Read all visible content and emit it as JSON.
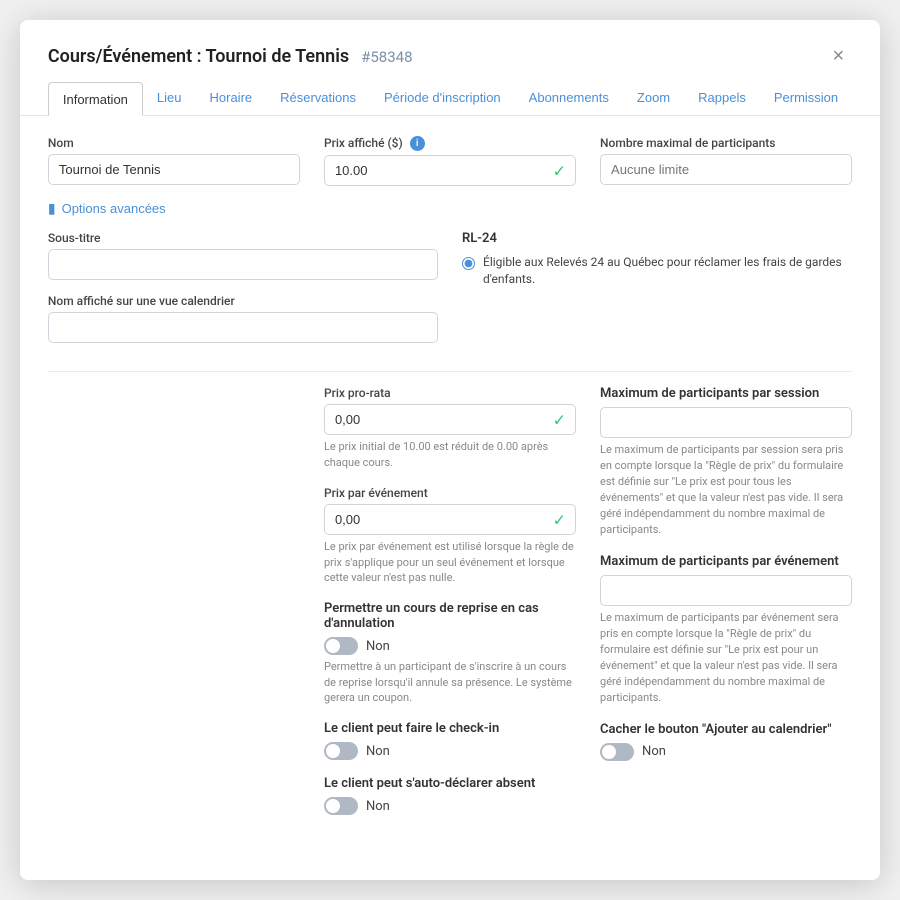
{
  "modal": {
    "title": "Cours/Événement : Tournoi de Tennis",
    "id": "#58348",
    "close_label": "×"
  },
  "tabs": [
    {
      "label": "Information",
      "active": true
    },
    {
      "label": "Lieu",
      "active": false
    },
    {
      "label": "Horaire",
      "active": false
    },
    {
      "label": "Réservations",
      "active": false
    },
    {
      "label": "Période d'inscription",
      "active": false
    },
    {
      "label": "Abonnements",
      "active": false
    },
    {
      "label": "Zoom",
      "active": false
    },
    {
      "label": "Rappels",
      "active": false
    },
    {
      "label": "Permission",
      "active": false
    }
  ],
  "form": {
    "nom_label": "Nom",
    "nom_value": "Tournoi de Tennis",
    "nom_placeholder": "",
    "prix_label": "Prix affiché ($)",
    "prix_value": "10.00",
    "participants_label": "Nombre maximal de participants",
    "participants_placeholder": "Aucune limite",
    "advanced_label": "Options avancées",
    "sous_titre_label": "Sous-titre",
    "sous_titre_value": "",
    "rl24_title": "RL-24",
    "rl24_radio_text": "Éligible aux Relevés 24 au Québec pour réclamer les frais de gardes d'enfants.",
    "nom_calendrier_label": "Nom affiché sur une vue calendrier",
    "nom_calendrier_value": "",
    "prix_prorata_label": "Prix pro-rata",
    "prix_prorata_value": "0,00",
    "prix_prorata_info": "Le prix initial de 10.00 est réduit de 0.00 après chaque cours.",
    "max_participants_session_label": "Maximum de participants par session",
    "max_participants_session_value": "",
    "max_participants_session_info": "Le maximum de participants par session sera pris en compte lorsque la \"Règle de prix\" du formulaire est définie sur \"Le prix est pour tous les événements\" et que la valeur n'est pas vide. Il sera géré indépendamment du nombre maximal de participants.",
    "prix_evenement_label": "Prix par événement",
    "prix_evenement_value": "0,00",
    "prix_evenement_info": "Le prix par événement est utilisé lorsque la règle de prix s'applique pour un seul événement et lorsque cette valeur n'est pas nulle.",
    "max_participants_evenement_label": "Maximum de participants par événement",
    "max_participants_evenement_value": "",
    "max_participants_evenement_info": "Le maximum de participants par événement sera pris en compte lorsque la \"Règle de prix\" du formulaire est définie sur \"Le prix est pour un événement\" et que la valeur n'est pas vide. Il sera géré indépendamment du nombre maximal de participants.",
    "reprise_label": "Permettre un cours de reprise en cas d'annulation",
    "reprise_toggle": false,
    "reprise_toggle_label": "Non",
    "reprise_info": "Permettre à un participant de s'inscrire à un cours de reprise lorsqu'il annule sa présence. Le système gerera un coupon.",
    "checkin_label": "Le client peut faire le check-in",
    "checkin_toggle": false,
    "checkin_toggle_label": "Non",
    "autodeclarer_label": "Le client peut s'auto-déclarer absent",
    "autodeclarer_toggle": false,
    "autodeclarer_toggle_label": "Non",
    "cacher_label": "Cacher le bouton \"Ajouter au calendrier\"",
    "cacher_toggle": false,
    "cacher_toggle_label": "Non"
  }
}
